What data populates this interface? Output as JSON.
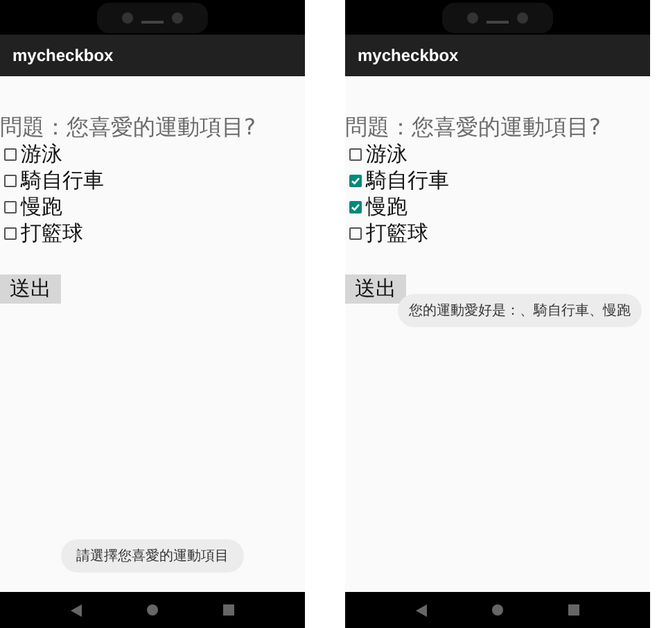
{
  "screens": [
    {
      "app_title": "mycheckbox",
      "question": "問題：您喜愛的運動項目?",
      "options": [
        {
          "label": "游泳",
          "checked": false
        },
        {
          "label": "騎自行車",
          "checked": false
        },
        {
          "label": "慢跑",
          "checked": false
        },
        {
          "label": "打籃球",
          "checked": false
        }
      ],
      "submit_button": "送出",
      "toast": {
        "text": "請選擇您喜愛的運動項目",
        "kind": "bottom"
      }
    },
    {
      "app_title": "mycheckbox",
      "question": "問題：您喜愛的運動項目?",
      "options": [
        {
          "label": "游泳",
          "checked": false
        },
        {
          "label": "騎自行車",
          "checked": true
        },
        {
          "label": "慢跑",
          "checked": true
        },
        {
          "label": "打籃球",
          "checked": false
        }
      ],
      "submit_button": "送出",
      "toast": {
        "text": "您的運動愛好是：、騎自行車、慢跑",
        "kind": "middle"
      }
    }
  ]
}
